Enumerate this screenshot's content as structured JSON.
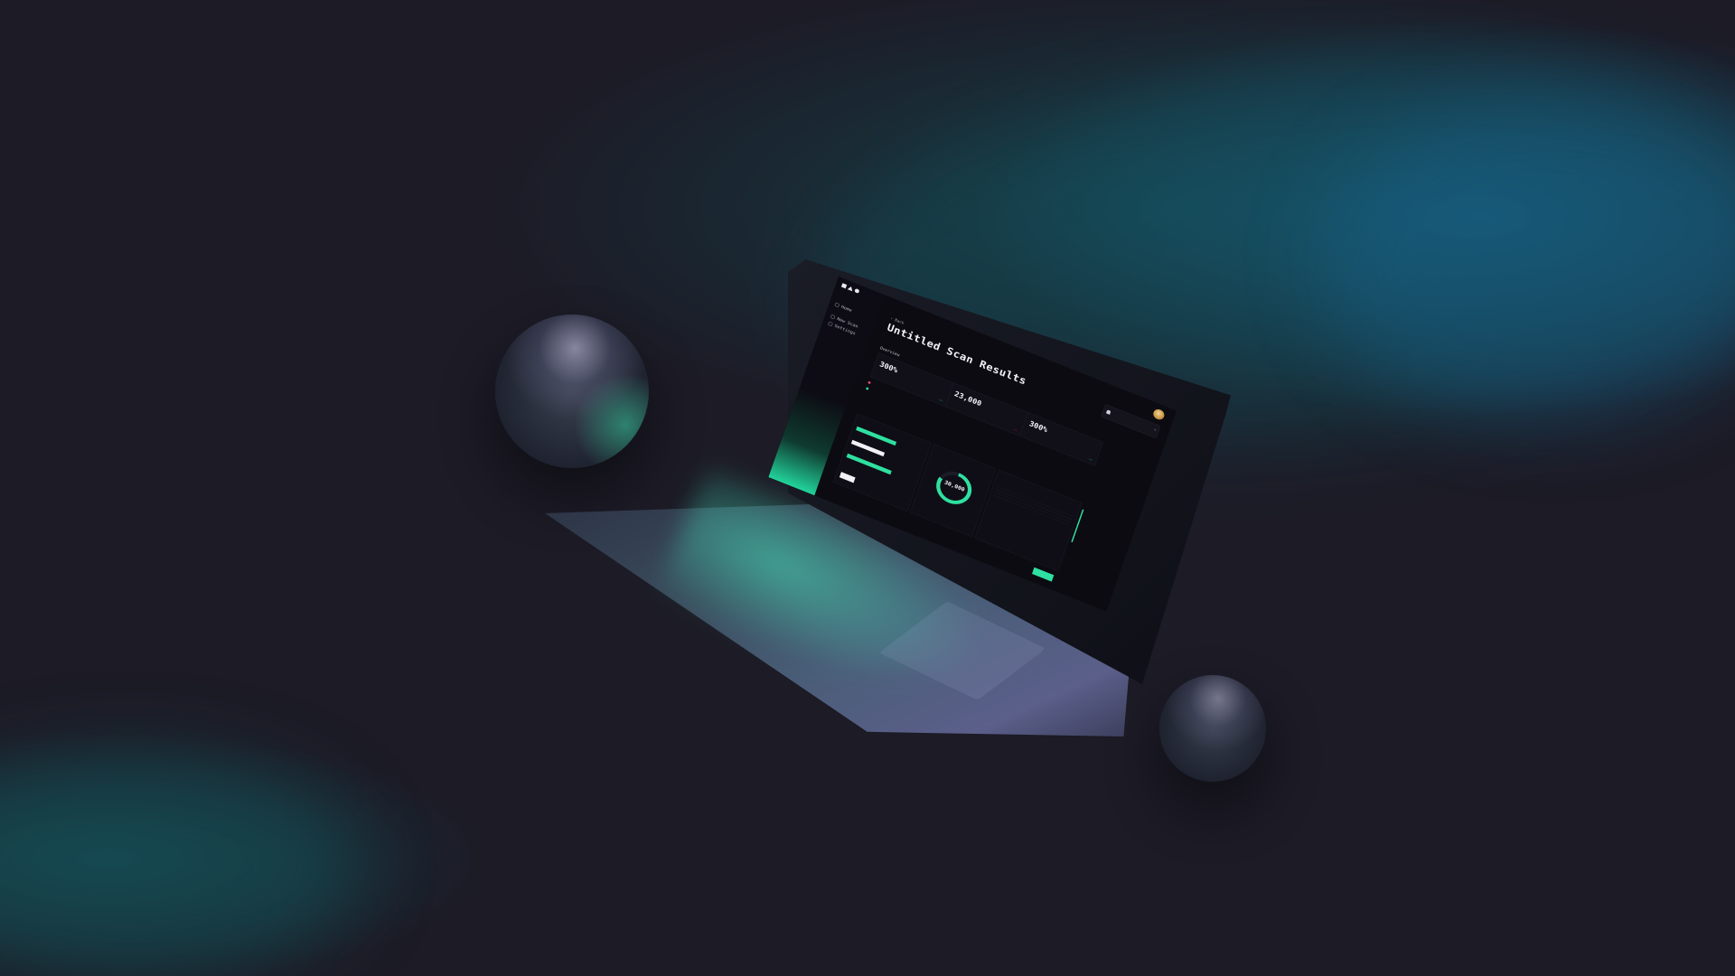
{
  "app": {
    "title": "Untitled Scan Results",
    "subtitle_prefix": "",
    "subtitle_accent": ""
  },
  "sidebar": {
    "items": [
      {
        "label": "Home",
        "icon": "home-icon"
      },
      {
        "label": "New Scan",
        "icon": "plus-icon"
      },
      {
        "label": "Settings",
        "icon": "gear-icon"
      }
    ]
  },
  "header": {
    "user_name": "",
    "user_sub": ""
  },
  "notification": {
    "text": ""
  },
  "main": {
    "back_label": "Back",
    "overview_label": "Overview",
    "stats": [
      {
        "label": "",
        "value": "300%",
        "badge": "",
        "trend": "up"
      },
      {
        "label": "",
        "value": "23,000",
        "badge": "",
        "trend": "down"
      },
      {
        "label": "",
        "value": "300%",
        "badge": "",
        "trend": "up"
      }
    ],
    "alerts": [
      {
        "text": "",
        "status": "red"
      },
      {
        "text": "",
        "status": "green"
      }
    ],
    "description": "",
    "description_bold": "",
    "donut": {
      "value": "30,000",
      "label": "",
      "fraction": 0.8
    },
    "bars": [
      {
        "label": "",
        "fraction": 0.85,
        "color": "#2fe0a0"
      },
      {
        "label": "",
        "fraction": 0.7,
        "color": "#f1f1f6"
      },
      {
        "label": "",
        "fraction": 0.95,
        "color": "#2fe0a0"
      }
    ]
  },
  "scan_info": {
    "title": "",
    "rows": [
      {
        "label": "",
        "value": ""
      },
      {
        "label": "",
        "value": ""
      },
      {
        "label": "",
        "value": ""
      },
      {
        "label": "",
        "value": ""
      }
    ]
  },
  "colors": {
    "accent": "#2fe0a0",
    "alert": "#ff4d6b",
    "background": "#1c1b26"
  }
}
